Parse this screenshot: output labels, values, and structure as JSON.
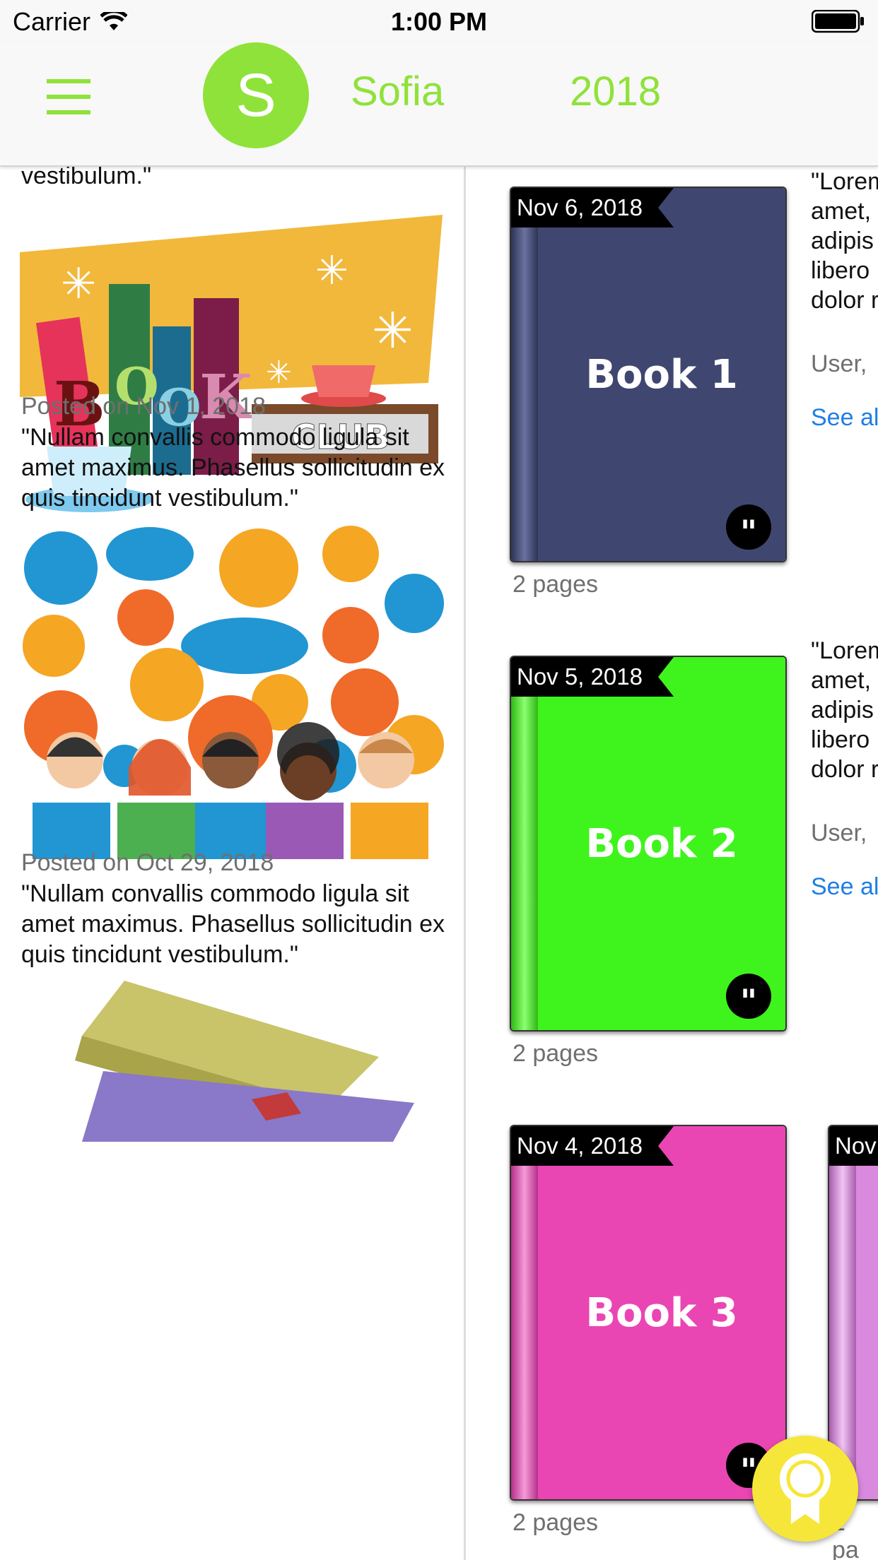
{
  "status_bar": {
    "carrier": "Carrier",
    "time": "1:00 PM"
  },
  "header": {
    "avatar_letter": "S",
    "name": "Sofia",
    "year": "2018"
  },
  "feed": {
    "top_tail": "vestibulum.\"",
    "posts": [
      {
        "date": "Posted on Nov 1, 2018",
        "text": "\"Nullam convallis commodo ligula sit amet maximus. Phasellus sollicitudin ex quis tincidunt vestibulum.\""
      },
      {
        "date": "Posted on Oct 29, 2018",
        "text": "\"Nullam convallis commodo ligula sit amet maximus. Phasellus sollicitudin ex quis tincidunt vestibulum.\""
      }
    ],
    "image_lettering": [
      "B",
      "O",
      "O",
      "K",
      "CLUB"
    ]
  },
  "books": [
    {
      "date": "Nov 6, 2018",
      "title": "Book 1",
      "pages": "2 pages",
      "color": "#3f4770",
      "snippet_lines": [
        "\"Lorem",
        "amet,",
        "adipis",
        "libero",
        "dolor r"
      ],
      "user": "User,",
      "link": "See al"
    },
    {
      "date": "Nov 5, 2018",
      "title": "Book 2",
      "pages": "2 pages",
      "color": "#3ff41c",
      "snippet_lines": [
        "\"Lorem",
        "amet,",
        "adipis",
        "libero",
        "dolor r"
      ],
      "user": "User,",
      "link": "See al"
    },
    {
      "date": "Nov 4, 2018",
      "title": "Book 3",
      "pages": "2 pages",
      "color": "#ea46b3"
    }
  ],
  "partial_book": {
    "date": "Nov",
    "color": "#d98ade",
    "pages": "2 pa"
  },
  "colors": {
    "accent": "#8fe23a",
    "fab": "#f7e63a",
    "link": "#1e7ee6"
  },
  "icons": {
    "menu": "hamburger-menu-icon",
    "fab": "award-ribbon-icon",
    "quote": "quote-icon"
  }
}
